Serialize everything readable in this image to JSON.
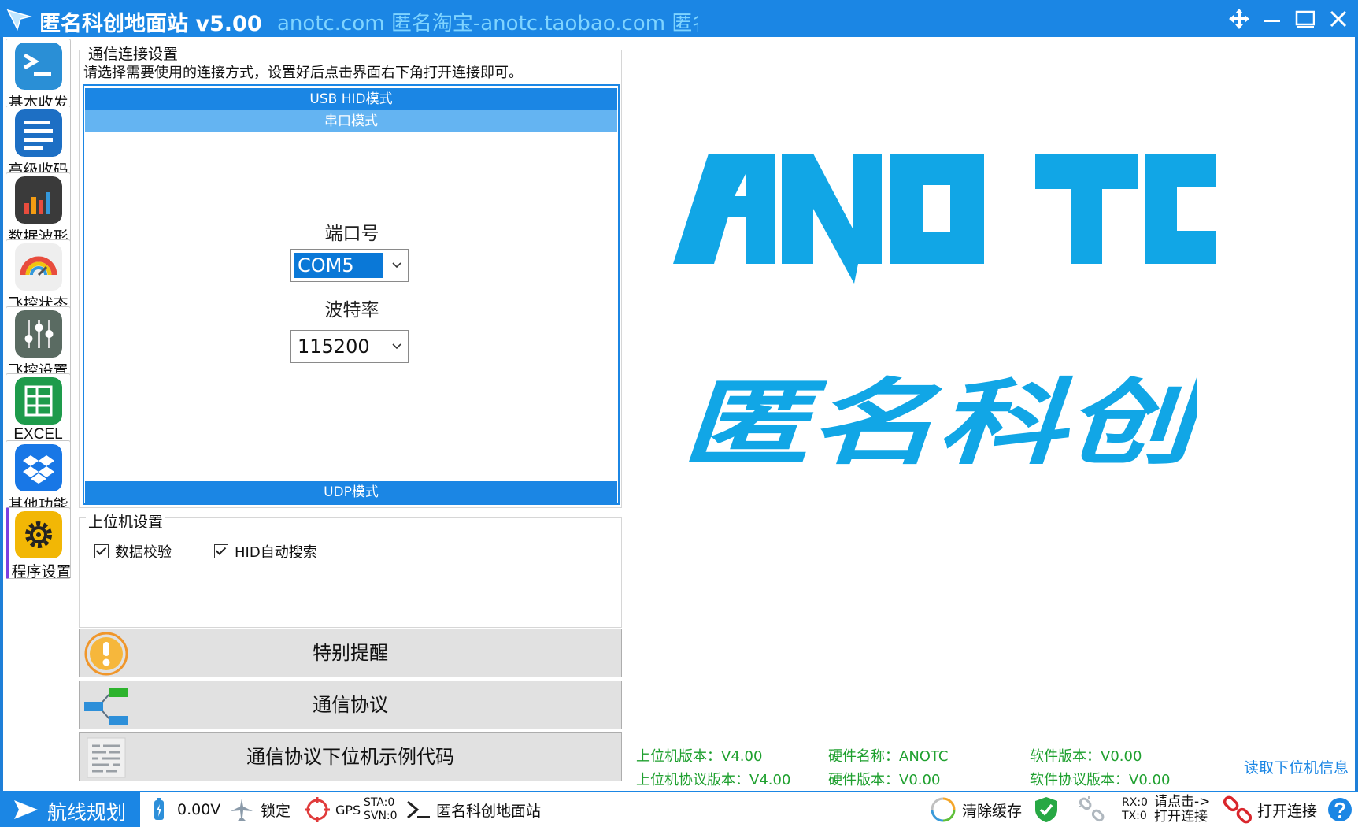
{
  "window": {
    "title": "匿名科创地面站 v5.00",
    "marquee": "anotc.com   匿名淘宝-anotc.taobao.com   匿名"
  },
  "nav": {
    "items": [
      {
        "label": "基本收发",
        "icon": "terminal-icon"
      },
      {
        "label": "高级收码",
        "icon": "list-icon"
      },
      {
        "label": "数据波形",
        "icon": "bar-chart-icon"
      },
      {
        "label": "飞控状态",
        "icon": "gauge-icon"
      },
      {
        "label": "飞控设置",
        "icon": "sliders-icon"
      },
      {
        "label": "EXCEL",
        "icon": "spreadsheet-icon"
      },
      {
        "label": "其他功能",
        "icon": "dropbox-icon"
      },
      {
        "label": "程序设置",
        "icon": "gear-icon"
      }
    ],
    "active": "程序设置"
  },
  "connection": {
    "group_title": "通信连接设置",
    "hint": "请选择需要使用的连接方式，设置好后点击界面右下角打开连接即可。",
    "modes": {
      "usb": "USB HID模式",
      "serial": "串口模式",
      "udp": "UDP模式"
    },
    "port_label": "端口号",
    "port_value": "COM5",
    "baud_label": "波特率",
    "baud_value": "115200"
  },
  "host_settings": {
    "group_title": "上位机设置",
    "checkboxes": [
      {
        "label": "数据校验",
        "checked": true
      },
      {
        "label": "HID自动搜索",
        "checked": true
      }
    ]
  },
  "buttons": {
    "notice": "特别提醒",
    "protocol": "通信协议",
    "sample_code": "通信协议下位机示例代码"
  },
  "logo": {
    "en": "ANO TC",
    "cn": "匿名科创",
    "color": "#11a6e6"
  },
  "version_info": {
    "host_version": "上位机版本：V4.00",
    "host_protocol_version": "上位机协议版本：V4.00",
    "hw_name": "硬件名称：ANOTC",
    "hw_version": "硬件版本：V0.00",
    "sw_version": "软件版本：V0.00",
    "sw_protocol_version": "软件协议版本：V0.00",
    "read_button": "读取下位机信息"
  },
  "statusbar": {
    "route": "航线规划",
    "voltage": "0.00V",
    "lock": "锁定",
    "gps": "GPS",
    "sta": "STA:0",
    "svn": "SVN:0",
    "app_name": "匿名科创地面站",
    "clear_cache": "清除缓存",
    "rx": "RX:0",
    "tx": "TX:0",
    "connect_hint_1": "请点击->",
    "connect_hint_2": "打开连接",
    "open_connection": "打开连接"
  },
  "colors": {
    "accent": "#1b86e4",
    "info_green": "#1fa02f",
    "logo_blue": "#11a6e6"
  }
}
